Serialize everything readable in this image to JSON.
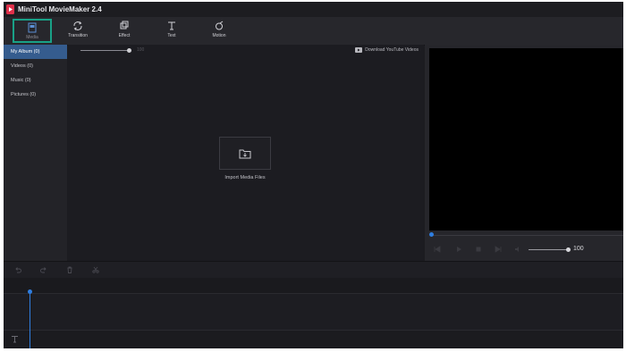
{
  "window": {
    "title": "MiniTool MovieMaker 2.4",
    "logo_icon": "minitool-logo-icon"
  },
  "toolbar": {
    "items": [
      {
        "label": "Media",
        "icon": "media-folder-icon",
        "active": true
      },
      {
        "label": "Transition",
        "icon": "transition-icon"
      },
      {
        "label": "Effect",
        "icon": "effect-icon"
      },
      {
        "label": "Text",
        "icon": "text-icon"
      },
      {
        "label": "Motion",
        "icon": "motion-icon"
      }
    ],
    "accent": "#19a187"
  },
  "sidebar": {
    "items": [
      {
        "label": "My Album  (0)",
        "active": true
      },
      {
        "label": "Videos  (0)"
      },
      {
        "label": "Music  (0)"
      },
      {
        "label": "Pictures  (0)"
      }
    ],
    "active_color": "#355c8e"
  },
  "media": {
    "zoom_value": "100",
    "download_label": "Download YouTube Videos",
    "import_label": "Import Media Files"
  },
  "preview": {
    "volume_value": "100",
    "volume_level": 1.0,
    "progress": 0.0,
    "accent": "#2f7ee0"
  },
  "timeline": {
    "tools": [
      "undo-icon",
      "redo-icon",
      "delete-icon",
      "cut-icon"
    ],
    "text_track_icon": "text-track-icon"
  }
}
